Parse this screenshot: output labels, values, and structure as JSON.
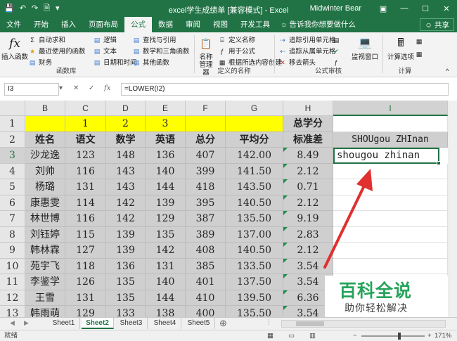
{
  "titlebar": {
    "title": "excel学生成绩单 [兼容模式] - Excel",
    "user": "Midwinter Bear",
    "save_icon": "save-icon",
    "undo_icon": "undo-icon",
    "redo_icon": "redo-icon",
    "new_icon": "new-file-icon",
    "customize_icon": "customize-qat-icon",
    "ribbon_display_icon": "ribbon-display-icon",
    "minimize": "—",
    "restore": "☐",
    "close": "✕"
  },
  "tabs": {
    "items": [
      "文件",
      "开始",
      "插入",
      "页面布局",
      "公式",
      "数据",
      "审阅",
      "视图",
      "开发工具"
    ],
    "active": "公式",
    "tellme": "告诉我你想要做什么",
    "share": "共享"
  },
  "ribbon": {
    "library": {
      "insert_function": "插入函数",
      "autosum": "自动求和",
      "recent": "最近使用的函数",
      "financial": "财务",
      "logical": "逻辑",
      "text": "文本",
      "datetime": "日期和时间",
      "lookup": "查找与引用",
      "math": "数学和三角函数",
      "more": "其他函数",
      "label": "函数库"
    },
    "names": {
      "name_manager": "名称管理器",
      "define": "定义名称",
      "use_in_formula": "用于公式",
      "create_from_selection": "根据所选内容创建",
      "label": "定义的名称"
    },
    "audit": {
      "trace_precedents": "追踪引用单元格",
      "trace_dependents": "追踪从属单元格",
      "remove_arrows": "移去箭头",
      "watch_window": "监视窗口",
      "label": "公式审核"
    },
    "calc": {
      "options": "计算选项",
      "label": "计算"
    }
  },
  "formula_bar": {
    "namebox": "I3",
    "cancel": "✕",
    "enter": "✓",
    "fx": "fx",
    "formula": "=LOWER(I2)"
  },
  "grid": {
    "columns": [
      "B",
      "C",
      "D",
      "E",
      "F",
      "G",
      "H",
      "I"
    ],
    "selected_column": "I",
    "rows": [
      "1",
      "2",
      "3",
      "4",
      "5",
      "6",
      "7",
      "8",
      "9",
      "10",
      "11",
      "12",
      "13"
    ],
    "selected_row": "3",
    "row1": {
      "C": "1",
      "D": "2",
      "E": "3",
      "H": "总学分"
    },
    "headers": [
      "姓名",
      "语文",
      "数学",
      "英语",
      "总分",
      "平均分",
      "标准差"
    ],
    "i2": "SHOUgou ZHInan",
    "i3": "shougou zhinan",
    "data": [
      [
        "沙龙逸",
        "123",
        "148",
        "136",
        "407",
        "142.00",
        "8.49"
      ],
      [
        "刘帅",
        "116",
        "143",
        "140",
        "399",
        "141.50",
        "2.12"
      ],
      [
        "杨璐",
        "131",
        "143",
        "144",
        "418",
        "143.50",
        "0.71"
      ],
      [
        "康惠雯",
        "114",
        "142",
        "139",
        "395",
        "140.50",
        "2.12"
      ],
      [
        "林世博",
        "116",
        "142",
        "129",
        "387",
        "135.50",
        "9.19"
      ],
      [
        "刘钰婷",
        "115",
        "139",
        "135",
        "389",
        "137.00",
        "2.83"
      ],
      [
        "韩林霖",
        "127",
        "139",
        "142",
        "408",
        "140.50",
        "2.12"
      ],
      [
        "苑宇飞",
        "118",
        "136",
        "131",
        "385",
        "133.50",
        "3.54"
      ],
      [
        "李鉴学",
        "126",
        "135",
        "140",
        "401",
        "137.50",
        "3.54"
      ],
      [
        "王雪",
        "131",
        "135",
        "144",
        "410",
        "139.50",
        "6.36"
      ],
      [
        "韩雨萌",
        "129",
        "133",
        "138",
        "400",
        "135.50",
        "3.54"
      ]
    ]
  },
  "sheets": {
    "items": [
      "Sheet1",
      "Sheet2",
      "Sheet3",
      "Sheet4",
      "Sheet5"
    ],
    "active": "Sheet2"
  },
  "status": {
    "mode": "就绪",
    "zoom": "171%",
    "minus": "−",
    "plus": "+"
  },
  "watermark": {
    "title": "百科全说",
    "subtitle": "助你轻松解决"
  },
  "colors": {
    "excel_green": "#217346",
    "yellow": "#ffff00",
    "cell_gray": "#cfcfcf",
    "arrow_red": "#e0302f",
    "watermark_green": "#27a35a"
  }
}
